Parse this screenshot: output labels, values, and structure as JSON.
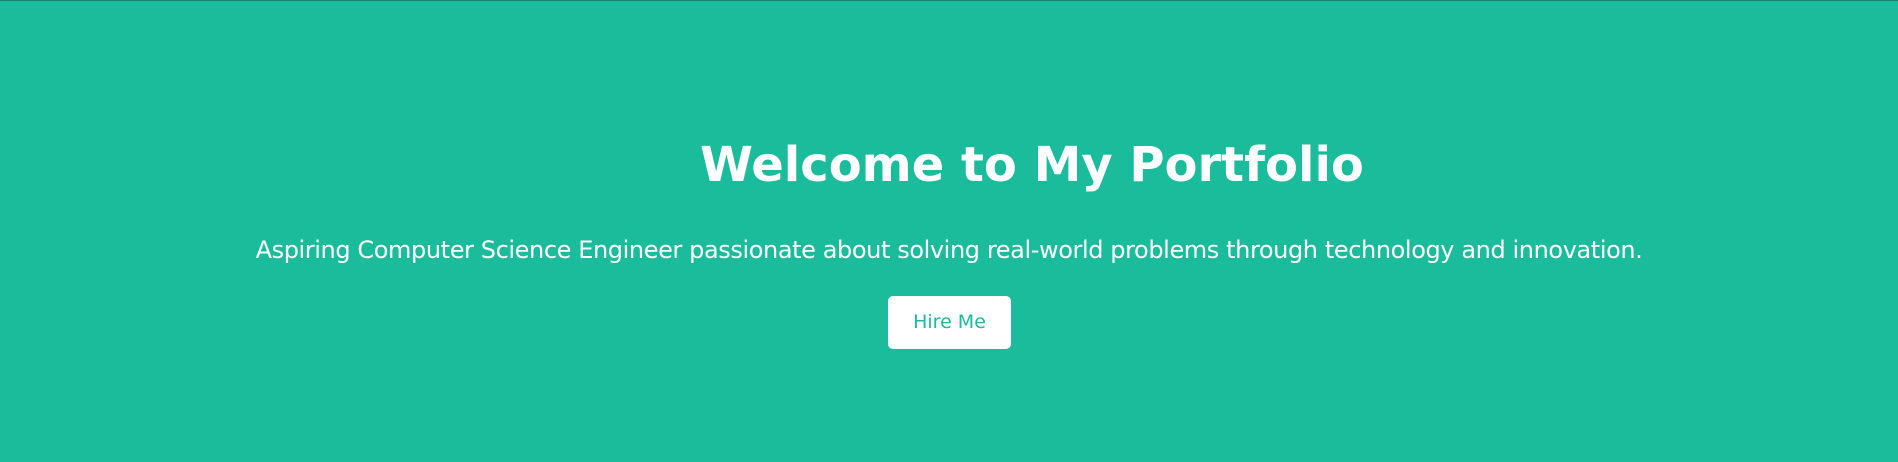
{
  "hero": {
    "title": "Welcome to My Portfolio",
    "subtitle": "Aspiring Computer Science Engineer passionate about solving real-world problems through technology and innovation.",
    "cta_label": "Hire Me"
  },
  "colors": {
    "background": "#1abc9c",
    "text": "#ffffff",
    "button_background": "#ffffff",
    "button_text": "#1abc9c"
  }
}
